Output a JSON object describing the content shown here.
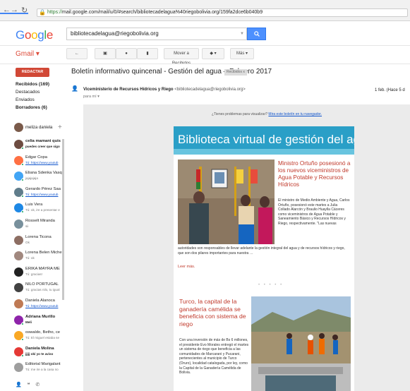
{
  "browser": {
    "url_scheme": "https://",
    "url_rest": "mail.google.com/mail/u/0/#search/bibliotecadelagua%40riegobolivia.org/159fa2dce6b040b9"
  },
  "header": {
    "logo": "Google",
    "search_value": "bibliotecadelagua@riegobolivia.org",
    "gmail_label": "Gmail ▾"
  },
  "toolbar": {
    "back": "←",
    "move_to": "Mover a Recibidos",
    "more": "Más ▾"
  },
  "sidebar": {
    "compose": "REDACTAR",
    "folders": [
      "Recibidos (169)",
      "Destacados",
      "Enviados",
      "Borradores (6)"
    ],
    "me": "meliza daniela",
    "plus": "+",
    "contacts": [
      {
        "name": "celia mamani quis",
        "msg": "puedes creer que sigo",
        "bold": true
      },
      {
        "name": "Edgar Copa",
        "msg": "Tú: https://www.youtub",
        "link": true
      },
      {
        "name": "Eliana Sdenka Vasq",
        "msg": "jajajajaja"
      },
      {
        "name": "Gerardo Pérez Saa",
        "msg": "Tú: https://www.youtub",
        "link": true
      },
      {
        "name": "Luis Vera",
        "msg": "Tú: ok, ire a presentar e"
      },
      {
        "name": "Rosselt Miranda",
        "msg": "sii"
      },
      {
        "name": "Lorena Ticona",
        "msg": "Ok"
      },
      {
        "name": "Lorena Belen Miche",
        "msg": "Tú: ok"
      },
      {
        "name": "ERIKA MAYRA ME",
        "msg": "Tú: gracias!"
      },
      {
        "name": "NILO PORTUGAL",
        "msg": "Tú: gracias nilo, tu igual"
      },
      {
        "name": "Daniela Alanoca",
        "msg": "Tú: https://www.youtub",
        "link": true
      },
      {
        "name": "Adriana Murillo",
        "msg": "Meli",
        "bold": true
      },
      {
        "name": "oswaldo, Betho, ce",
        "msg": "Tú: El miguel estaba se"
      },
      {
        "name": "Daniela Molina",
        "msg": "jjjjj okí yo te aviso",
        "bold": true
      },
      {
        "name": "Editorial Marigalant",
        "msg": "Tú: me ire a la casa no"
      }
    ]
  },
  "email": {
    "subject": "Boletín informativo quincenal - Gestión del agua – Febrero 2017",
    "label": "Recibidos  x",
    "sender_name": "Viceministerio de Recursos Hídricos y Riego",
    "sender_email": "<bibliotecadelagua@riegobolivia.org>",
    "to": "para mí ▾",
    "date": "1 feb. (Hace 5 d"
  },
  "newsletter": {
    "view_note": "¿Tienes problemas para visualizar?",
    "view_link": "Mira este boletín en tu navegador.",
    "banner_title": "Biblioteca virtual de gestión del agua",
    "article1_title": "Ministro Ortuño posesionó a los nuevos viceministros de Agua Potable y Recursos Hídricos",
    "article1_text": "El ministro de Medio Ambiente y Agua, Carlos Ortuño, posesionó este martes a Julia Collado Alarcón y Braulio Huaylla Cáceres como viceministros de Agua Potable y Saneamiento Básico y Recursos Hídricos y Riego, respectivamente. \"Las nuevas",
    "article1_cont": "autoridades son responsables de llevar adelante la gestión integral del agua y de recursos hídricos y riego, que son dos pilares importantes para nuestra …",
    "read_more": "Leer más.",
    "article2_title": "Turco, la capital de la ganadería camélida se beneficia con sistema de riego",
    "article2_text": "Con una inversión de más de Bs 6 millones, el presidente Evo Morales entregó el martes un sistema de riego que beneficia a las comunidades de Marcarani y Pucarani, pertenecientes al municipio de Turco (Oruro), localidad catalogada, por ley, como la Capital de la Ganadería Camélida de Bolivia."
  },
  "colors": {
    "accent_red": "#dd4b39",
    "compose_red": "#d14836",
    "search_blue": "#4d90fe",
    "banner_blue": "#2a9fc7",
    "headline_red": "#c0392b"
  }
}
